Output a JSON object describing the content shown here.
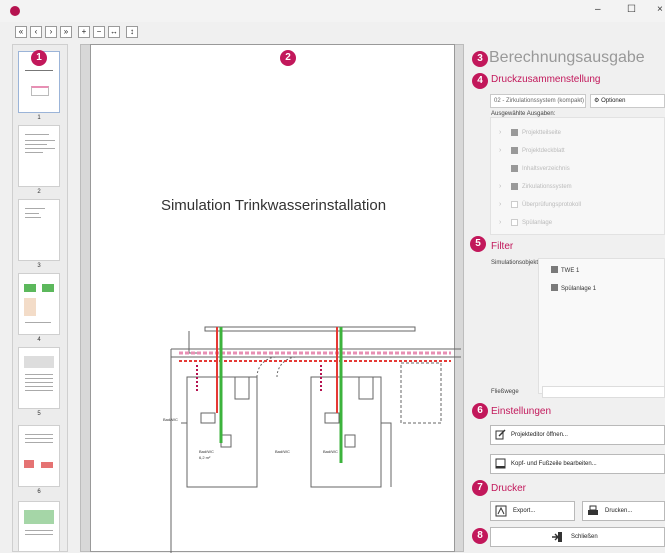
{
  "window": {
    "minimize": "–",
    "maximize": "☐",
    "close": "×"
  },
  "toolbar": {
    "buttons": [
      {
        "name": "first-page",
        "glyph": "«"
      },
      {
        "name": "prev-page",
        "glyph": "‹"
      },
      {
        "name": "next-page",
        "glyph": "›"
      },
      {
        "name": "last-page",
        "glyph": "»"
      },
      {
        "name": "zoom-in",
        "glyph": "+"
      },
      {
        "name": "zoom-out",
        "glyph": "−"
      },
      {
        "name": "fit-width",
        "glyph": "↔"
      },
      {
        "name": "fit-height",
        "glyph": "↕"
      }
    ]
  },
  "thumbnails": {
    "pages": [
      "1",
      "2",
      "3",
      "4",
      "5",
      "6"
    ]
  },
  "preview": {
    "page_title": "Simulation Trinkwasserinstallation",
    "room_label_1": "Bad/WC",
    "room_label_2": "Bad/WC",
    "room_label_3": "Bad/WC",
    "room_label_4": "Bad/WC",
    "area": "6,2 m²"
  },
  "badges": [
    "1",
    "2",
    "3",
    "4",
    "5",
    "6",
    "7",
    "8"
  ],
  "right_panel": {
    "title": "Berechnungsausgabe",
    "druck": {
      "heading": "Druckzusammenstellung",
      "preset": "02 - Zirkulationssystem (kompakt)",
      "options_label": "Optionen",
      "selected_label": "Ausgewählte Ausgaben:",
      "items": [
        {
          "label": "Projektteilseite",
          "checked": true,
          "arrow": true
        },
        {
          "label": "Projektdeckblatt",
          "checked": true,
          "arrow": true
        },
        {
          "label": "Inhaltsverzeichnis",
          "checked": true,
          "arrow": false
        },
        {
          "label": "Zirkulationssystem",
          "checked": true,
          "arrow": true
        },
        {
          "label": "Überprüfungsprotokoll",
          "checked": false,
          "arrow": true
        },
        {
          "label": "Spülanlage",
          "checked": false,
          "arrow": true
        }
      ]
    },
    "filter": {
      "heading": "Filter",
      "objects_label": "Simulationsobjekte",
      "objects": [
        "TWE 1",
        "Spülanlage 1"
      ],
      "paths_label": "Fließwege"
    },
    "settings": {
      "heading": "Einstellungen",
      "editor_button": "Projekteditor öffnen...",
      "header_footer_button": "Kopf- und Fußzeile bearbeiten..."
    },
    "printer": {
      "heading": "Drucker",
      "export_button": "Export...",
      "print_button": "Drucken..."
    },
    "close_button": "Schließen"
  },
  "colors": {
    "accent": "#c2185b",
    "pipe_green": "#3cb33c",
    "pipe_red": "#e53935",
    "pipe_pink": "#e88fb4"
  }
}
